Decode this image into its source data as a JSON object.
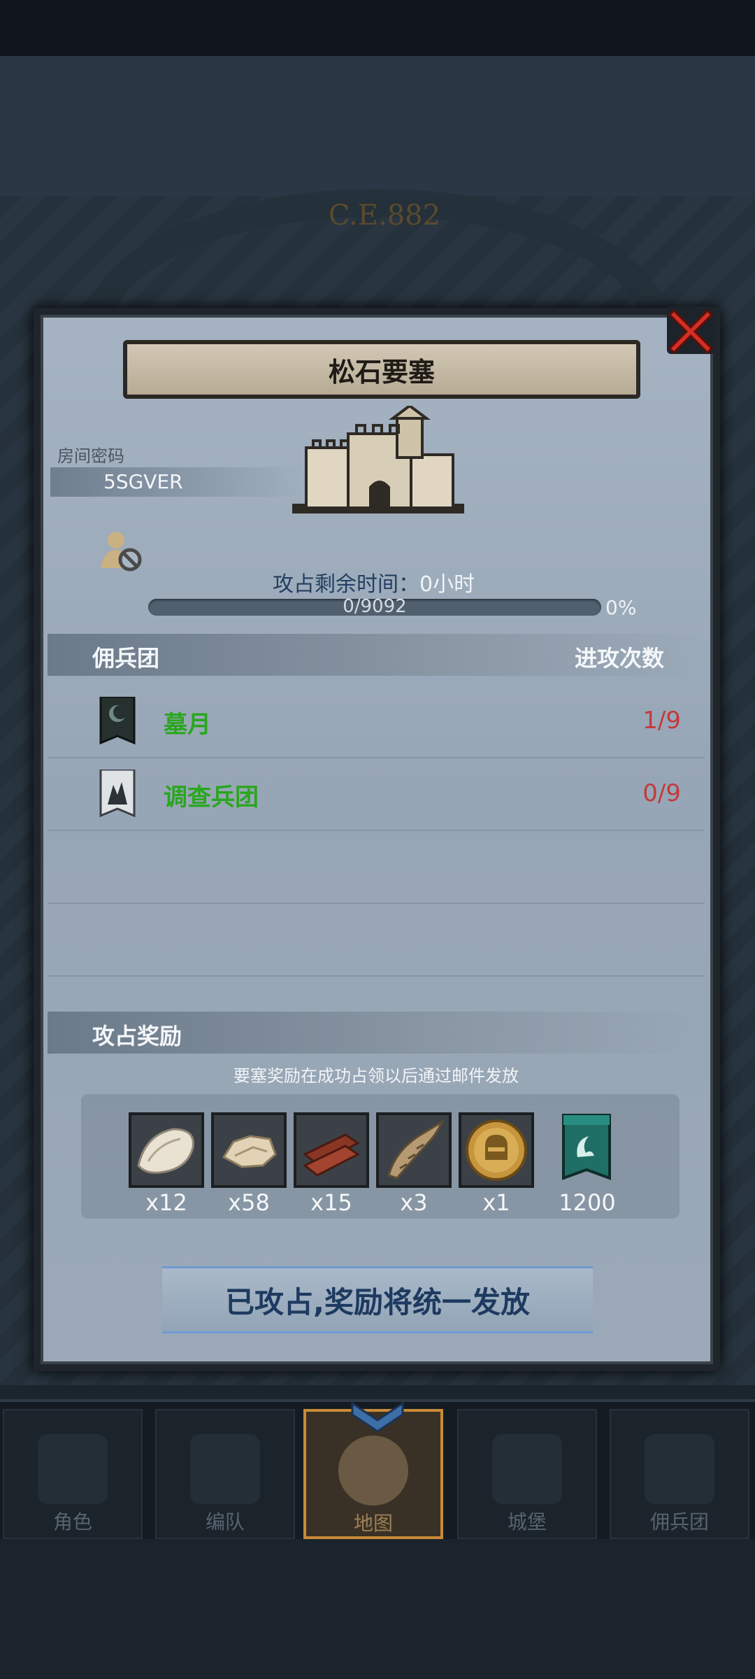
{
  "background": {
    "year_label": "C.E.882"
  },
  "dialog": {
    "title": "松石要塞",
    "room_password_label": "房间密码",
    "room_password_value": "5SGVER",
    "remaining_time_label": "攻占剩余时间：",
    "remaining_time_value": "0小时",
    "progress": {
      "text": "0/9092",
      "percent_label": "0%",
      "fraction": 0
    },
    "mercenary_section": {
      "title": "佣兵团",
      "right_header": "进攻次数",
      "rows": [
        {
          "name": "墓月",
          "count": "1/9",
          "icon": "dark-banner-icon"
        },
        {
          "name": "调查兵团",
          "count": "0/9",
          "icon": "white-banner-icon"
        }
      ]
    },
    "reward_section": {
      "title": "攻占奖励",
      "note": "要塞奖励在成功占领以后通过邮件发放",
      "items": [
        {
          "icon": "fur-icon",
          "count": "x12"
        },
        {
          "icon": "leather-icon",
          "count": "x58"
        },
        {
          "icon": "wood-planks-icon",
          "count": "x15"
        },
        {
          "icon": "horn-icon",
          "count": "x3"
        },
        {
          "icon": "helmet-coin-icon",
          "count": "x1"
        },
        {
          "icon": "guild-token-icon",
          "count": "1200"
        }
      ]
    },
    "status_button": "已攻占,奖励将统一发放"
  },
  "bottom_nav": [
    {
      "label": "角色",
      "active": false
    },
    {
      "label": "编队",
      "active": false
    },
    {
      "label": "地图",
      "active": true
    },
    {
      "label": "城堡",
      "active": false
    },
    {
      "label": "佣兵团",
      "active": false
    }
  ],
  "colors": {
    "guild_name": "#2aa61f",
    "attack_count": "#c33a3a",
    "active_tab_border": "#c98a38"
  }
}
